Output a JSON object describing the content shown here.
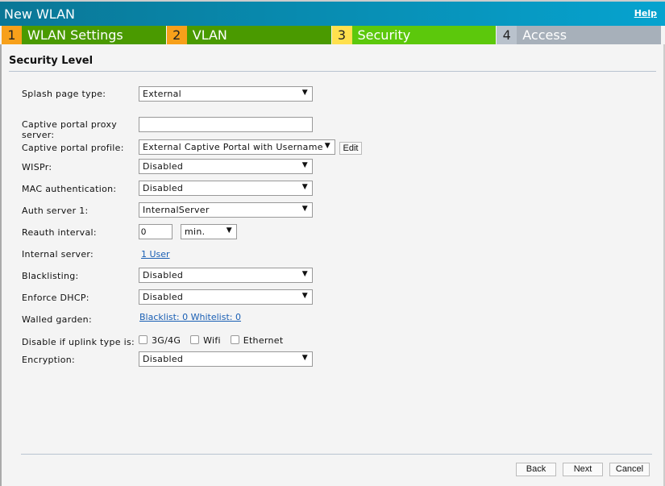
{
  "window": {
    "title": "New WLAN",
    "help": "Help"
  },
  "steps": [
    {
      "num": "1",
      "label": "WLAN Settings",
      "num_color": "#f7a01a",
      "color": "#4a9a00"
    },
    {
      "num": "2",
      "label": "VLAN",
      "num_color": "#f7a01a",
      "color": "#4a9a00"
    },
    {
      "num": "3",
      "label": "Security",
      "num_color": "#ffe04d",
      "color": "#5cc80c"
    },
    {
      "num": "4",
      "label": "Access",
      "num_color": "#b9c2cc",
      "color": "#a7b0ba"
    }
  ],
  "section": "Security Level",
  "form": {
    "splash": {
      "label": "Splash page type:",
      "value": "External"
    },
    "proxy": {
      "label": "Captive portal proxy server:",
      "value": ""
    },
    "profile": {
      "label": "Captive portal profile:",
      "value": "External Captive Portal with Username",
      "edit": "Edit"
    },
    "wispr": {
      "label": "WISPr:",
      "value": "Disabled"
    },
    "mac": {
      "label": "MAC authentication:",
      "value": "Disabled"
    },
    "auth": {
      "label": "Auth server 1:",
      "value": "InternalServer"
    },
    "reauth": {
      "label": "Reauth interval:",
      "value": "0",
      "unit": "min."
    },
    "internal": {
      "label": "Internal server:",
      "link": "1 User"
    },
    "blacklisting": {
      "label": "Blacklisting:",
      "value": "Disabled"
    },
    "dhcp": {
      "label": "Enforce DHCP:",
      "value": "Disabled"
    },
    "walled": {
      "label": "Walled garden:",
      "link": "Blacklist: 0 Whitelist: 0"
    },
    "uplink": {
      "label": "Disable if uplink type is:",
      "options": [
        "3G/4G",
        "Wifi",
        "Ethernet"
      ]
    },
    "encryption": {
      "label": "Encryption:",
      "value": "Disabled"
    }
  },
  "buttons": {
    "back": "Back",
    "next": "Next",
    "cancel": "Cancel"
  }
}
